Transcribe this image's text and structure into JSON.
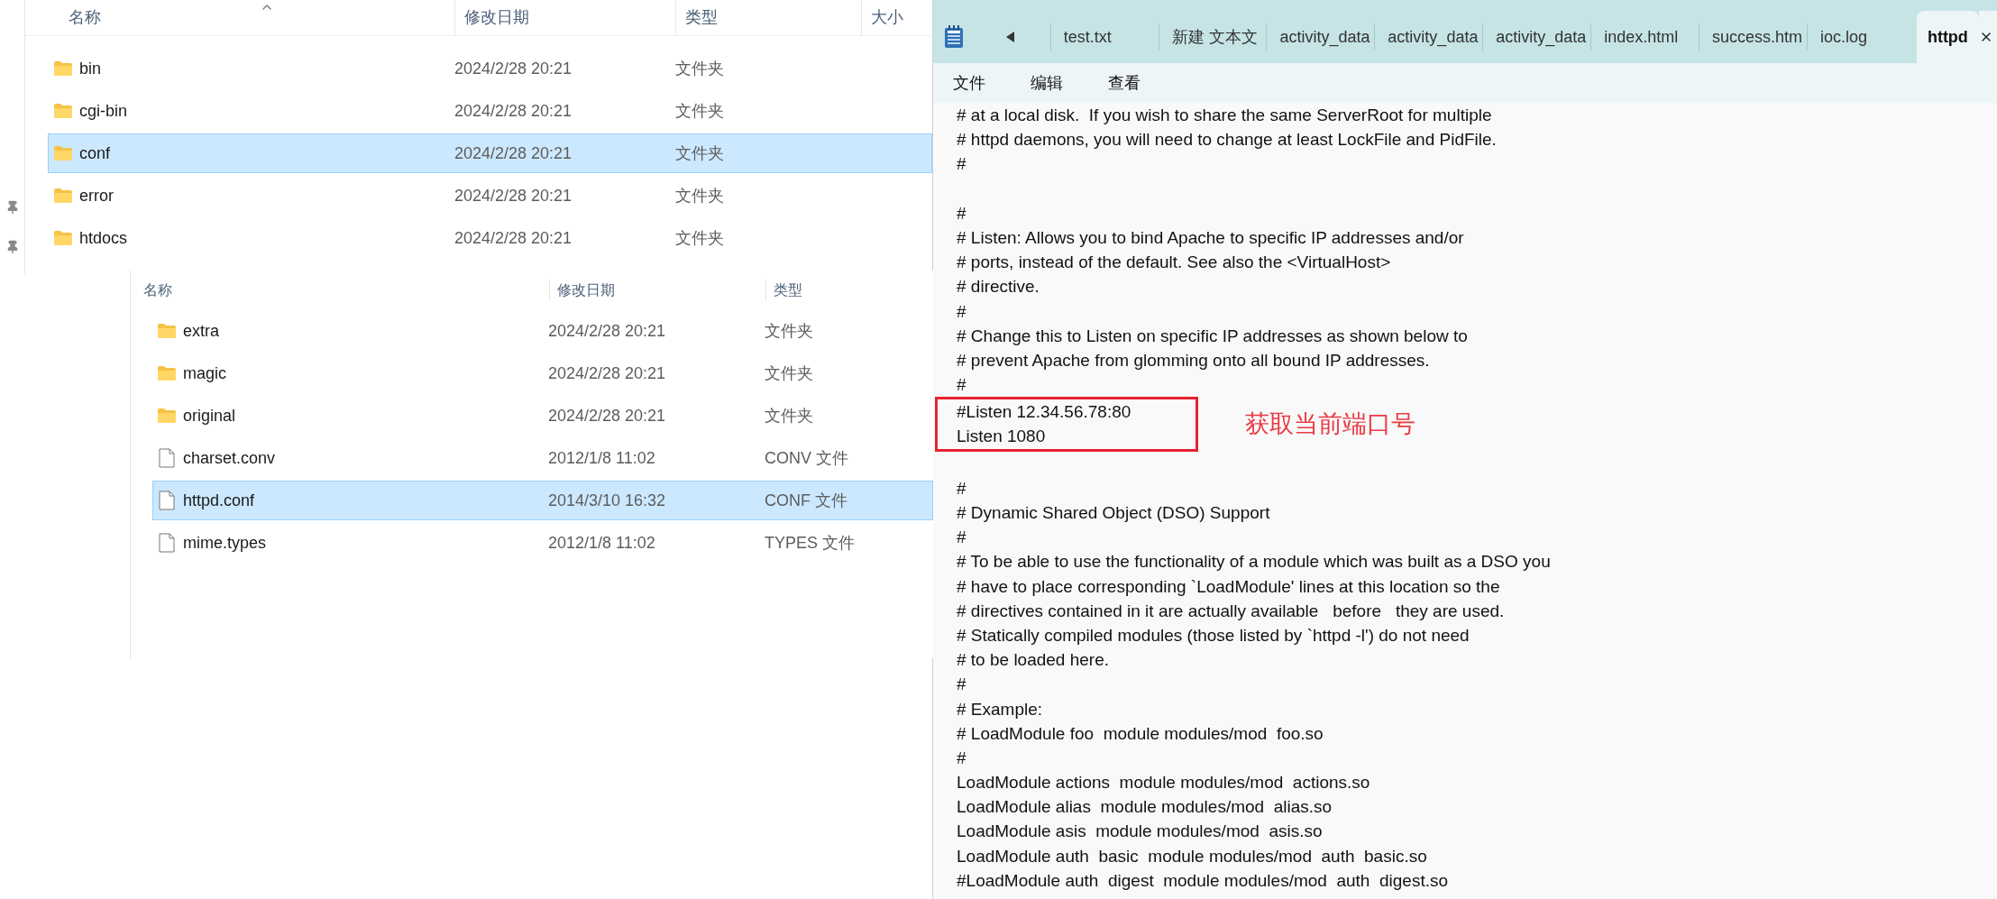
{
  "explorer_top": {
    "columns": [
      "名称",
      "修改日期",
      "类型",
      "大小"
    ],
    "rows": [
      {
        "kind": "folder",
        "name": "bin",
        "date": "2024/2/28 20:21",
        "type": "文件夹",
        "selected": false
      },
      {
        "kind": "folder",
        "name": "cgi-bin",
        "date": "2024/2/28 20:21",
        "type": "文件夹",
        "selected": false
      },
      {
        "kind": "folder",
        "name": "conf",
        "date": "2024/2/28 20:21",
        "type": "文件夹",
        "selected": true
      },
      {
        "kind": "folder",
        "name": "error",
        "date": "2024/2/28 20:21",
        "type": "文件夹",
        "selected": false
      },
      {
        "kind": "folder",
        "name": "htdocs",
        "date": "2024/2/28 20:21",
        "type": "文件夹",
        "selected": false
      }
    ]
  },
  "explorer_conf": {
    "columns": [
      "名称",
      "修改日期",
      "类型"
    ],
    "rows": [
      {
        "kind": "folder",
        "name": "extra",
        "date": "2024/2/28 20:21",
        "type": "文件夹",
        "selected": false
      },
      {
        "kind": "folder",
        "name": "magic",
        "date": "2024/2/28 20:21",
        "type": "文件夹",
        "selected": false
      },
      {
        "kind": "folder",
        "name": "original",
        "date": "2024/2/28 20:21",
        "type": "文件夹",
        "selected": false
      },
      {
        "kind": "file",
        "name": "charset.conv",
        "date": "2012/1/8 11:02",
        "type": "CONV 文件",
        "selected": false
      },
      {
        "kind": "file",
        "name": "httpd.conf",
        "date": "2014/3/10 16:32",
        "type": "CONF 文件",
        "selected": true
      },
      {
        "kind": "file",
        "name": "mime.types",
        "date": "2012/1/8 11:02",
        "type": "TYPES 文件",
        "selected": false
      }
    ]
  },
  "notepad": {
    "tabs": [
      {
        "label": "test.txt",
        "selected": false
      },
      {
        "label": "新建 文本文",
        "selected": false
      },
      {
        "label": "activity_data",
        "selected": false
      },
      {
        "label": "activity_data",
        "selected": false
      },
      {
        "label": "activity_data",
        "selected": false
      },
      {
        "label": "index.html",
        "selected": false
      },
      {
        "label": "success.htm",
        "selected": false
      },
      {
        "label": "ioc.log",
        "selected": false
      },
      {
        "label": "httpd",
        "selected": true
      }
    ],
    "menu": [
      "文件",
      "编辑",
      "查看"
    ],
    "segments": [
      {
        "kind": "text",
        "lines": [
          "# at a local disk.  If you wish to share the same ServerRoot for multiple",
          "# httpd daemons, you will need to change at least LockFile and PidFile.",
          "#"
        ]
      },
      {
        "kind": "gap"
      },
      {
        "kind": "text",
        "lines": [
          "#",
          "# Listen: Allows you to bind Apache to specific IP addresses and/or",
          "# ports, instead of the default. See also the <VirtualHost>",
          "# directive.",
          "#",
          "# Change this to Listen on specific IP addresses as shown below to",
          "# prevent Apache from glomming onto all bound IP addresses.",
          "#"
        ]
      },
      {
        "kind": "highlight",
        "lines": [
          "#Listen 12.34.56.78:80",
          "Listen 1080"
        ],
        "note": "获取当前端口号"
      },
      {
        "kind": "gap"
      },
      {
        "kind": "text",
        "lines": [
          "#",
          "# Dynamic Shared Object (DSO) Support",
          "#",
          "# To be able to use the functionality of a module which was built as a DSO you",
          "# have to place corresponding `LoadModule' lines at this location so the",
          "# directives contained in it are actually available   before   they are used.",
          "# Statically compiled modules (those listed by `httpd -l') do not need",
          "# to be loaded here.",
          "#",
          "# Example:",
          "# LoadModule foo  module modules/mod  foo.so",
          "#",
          "LoadModule actions  module modules/mod  actions.so",
          "LoadModule alias  module modules/mod  alias.so",
          "LoadModule asis  module modules/mod  asis.so",
          "LoadModule auth  basic  module modules/mod  auth  basic.so",
          "#LoadModule auth  digest  module modules/mod  auth  digest.so"
        ]
      }
    ]
  }
}
